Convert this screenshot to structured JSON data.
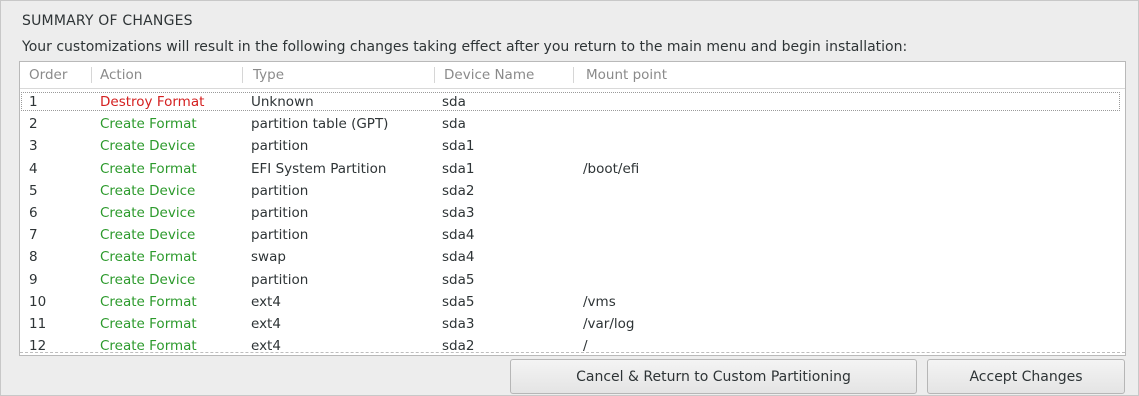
{
  "dialog": {
    "title": "SUMMARY OF CHANGES",
    "subtitle": "Your customizations will result in the following changes taking effect after you return to the main menu and begin installation:"
  },
  "table": {
    "headers": {
      "order": "Order",
      "action": "Action",
      "type": "Type",
      "device": "Device Name",
      "mount": "Mount point"
    },
    "rows": [
      {
        "order": "1",
        "action": "Destroy Format",
        "kind": "destroy",
        "type": "Unknown",
        "device": "sda",
        "mount": ""
      },
      {
        "order": "2",
        "action": "Create Format",
        "kind": "create",
        "type": "partition table (GPT)",
        "device": "sda",
        "mount": ""
      },
      {
        "order": "3",
        "action": "Create Device",
        "kind": "create",
        "type": "partition",
        "device": "sda1",
        "mount": ""
      },
      {
        "order": "4",
        "action": "Create Format",
        "kind": "create",
        "type": "EFI System Partition",
        "device": "sda1",
        "mount": "/boot/efi"
      },
      {
        "order": "5",
        "action": "Create Device",
        "kind": "create",
        "type": "partition",
        "device": "sda2",
        "mount": ""
      },
      {
        "order": "6",
        "action": "Create Device",
        "kind": "create",
        "type": "partition",
        "device": "sda3",
        "mount": ""
      },
      {
        "order": "7",
        "action": "Create Device",
        "kind": "create",
        "type": "partition",
        "device": "sda4",
        "mount": ""
      },
      {
        "order": "8",
        "action": "Create Format",
        "kind": "create",
        "type": "swap",
        "device": "sda4",
        "mount": ""
      },
      {
        "order": "9",
        "action": "Create Device",
        "kind": "create",
        "type": "partition",
        "device": "sda5",
        "mount": ""
      },
      {
        "order": "10",
        "action": "Create Format",
        "kind": "create",
        "type": "ext4",
        "device": "sda5",
        "mount": "/vms"
      },
      {
        "order": "11",
        "action": "Create Format",
        "kind": "create",
        "type": "ext4",
        "device": "sda3",
        "mount": "/var/log"
      },
      {
        "order": "12",
        "action": "Create Format",
        "kind": "create",
        "type": "ext4",
        "device": "sda2",
        "mount": "/"
      }
    ]
  },
  "buttons": {
    "cancel_label": "Cancel & Return to Custom Partitioning",
    "accept_label": "Accept Changes"
  },
  "colors": {
    "destroy": "#d42020",
    "create": "#2c9a2c"
  }
}
